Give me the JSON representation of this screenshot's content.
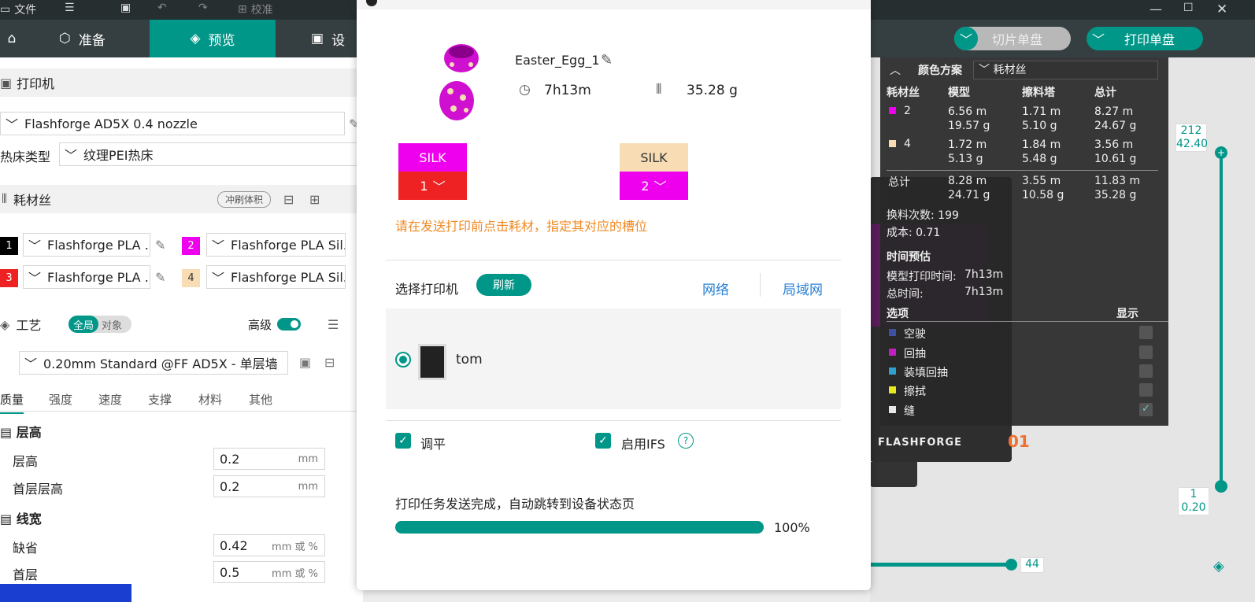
{
  "topbar": {
    "file_label": "文件",
    "calibrate_label": "校准"
  },
  "tabs": [
    {
      "label": "准备"
    },
    {
      "label": "预览"
    },
    {
      "label": "设"
    }
  ],
  "actions": {
    "slice_label": "切片单盘",
    "print_label": "打印单盘"
  },
  "left": {
    "printer_section": "打印机",
    "printer_value": "Flashforge AD5X 0.4 nozzle",
    "bed_type_label": "热床类型",
    "bed_type_value": "纹理PEI热床",
    "filament_section": "耗材丝",
    "flush_label": "冲刷体积",
    "filaments": [
      {
        "num": "1",
        "name": "Flashforge PLA ...",
        "color": "#000000",
        "text_color": "#ffffff"
      },
      {
        "num": "2",
        "name": "Flashforge PLA Sil...",
        "color": "#ee00ee",
        "text_color": "#ffffff"
      },
      {
        "num": "3",
        "name": "Flashforge PLA ...",
        "color": "#ee2222",
        "text_color": "#ffffff"
      },
      {
        "num": "4",
        "name": "Flashforge PLA Sil...",
        "color": "#f7dcb4",
        "text_color": "#333333"
      }
    ],
    "process_section": "工艺",
    "global_label": "全局",
    "object_label": "对象",
    "advanced_label": "高级",
    "profile_value": "0.20mm Standard @FF AD5X - 单层墙",
    "subtabs": [
      "质量",
      "强度",
      "速度",
      "支撑",
      "材料",
      "其他"
    ],
    "layer_group": "层高",
    "layer_height_label": "层高",
    "layer_height_value": "0.2",
    "mm": "mm",
    "first_layer_label": "首层层高",
    "first_layer_value": "0.2",
    "line_width_group": "线宽",
    "default_label": "缺省",
    "default_value": "0.42",
    "mm_or_pct": "mm 或 %",
    "first_label": "首层",
    "first_value": "0.5"
  },
  "dialog": {
    "filename": "Easter_Egg_1",
    "time": "7h13m",
    "weight": "35.28 g",
    "slots": [
      {
        "material": "SILK",
        "slot": "1",
        "top_color": "#ee00ee",
        "bottom_color": "#ee2222"
      },
      {
        "material": "SILK",
        "slot": "2",
        "top_color": "#f7dcb4",
        "bottom_color": "#ee00ee"
      }
    ],
    "hint": "请在发送打印前点击耗材，指定其对应的槽位",
    "select_printer": "选择打印机",
    "refresh": "刷新",
    "network": "网络",
    "lan": "局域网",
    "printer_name": "tom",
    "level_label": "调平",
    "ifs_label": "启用IFS",
    "status": "打印任务发送完成，自动跳转到设备状态页",
    "progress": 1.0,
    "progress_text": "100%"
  },
  "legend": {
    "title": "颜色方案",
    "scheme": "耗材丝",
    "headers": [
      "耗材丝",
      "模型",
      "擦料塔",
      "总计"
    ],
    "rows": [
      {
        "id": "2",
        "color": "#ee00ee",
        "model_m": "6.56 m",
        "model_g": "19.57 g",
        "tower_m": "1.71 m",
        "tower_g": "5.10 g",
        "total_m": "8.27 m",
        "total_g": "24.67 g"
      },
      {
        "id": "4",
        "color": "#f7dcb4",
        "model_m": "1.72 m",
        "model_g": "5.13 g",
        "tower_m": "1.84 m",
        "tower_g": "5.48 g",
        "total_m": "3.56 m",
        "total_g": "10.61 g"
      }
    ],
    "total_label": "总计",
    "total_model_m": "8.28 m",
    "total_model_g": "24.71 g",
    "total_tower_m": "3.55 m",
    "total_tower_g": "10.58 g",
    "total_m": "11.83 m",
    "total_g": "35.28 g",
    "changes": "换料次数: 199",
    "cost": "成本: 0.71",
    "time_title": "时间预估",
    "model_time_label": "模型打印时间:",
    "model_time": "7h13m",
    "total_time_label": "总时间:",
    "total_time": "7h13m",
    "options_label": "选项",
    "display_label": "显示",
    "options": [
      {
        "label": "空驶",
        "color": "#4050a0"
      },
      {
        "label": "回抽",
        "color": "#c020c0"
      },
      {
        "label": "装填回抽",
        "color": "#30a0d0"
      },
      {
        "label": "擦拭",
        "color": "#e8e820"
      },
      {
        "label": "缝",
        "color": "#e8e8e8"
      }
    ]
  },
  "slider": {
    "top_layer": "212",
    "top_height": "42.40",
    "bottom_layer": "1",
    "bottom_height": "0.20",
    "horiz_value": "44"
  },
  "brand": "FLASHFORGE",
  "plate_num": "01"
}
